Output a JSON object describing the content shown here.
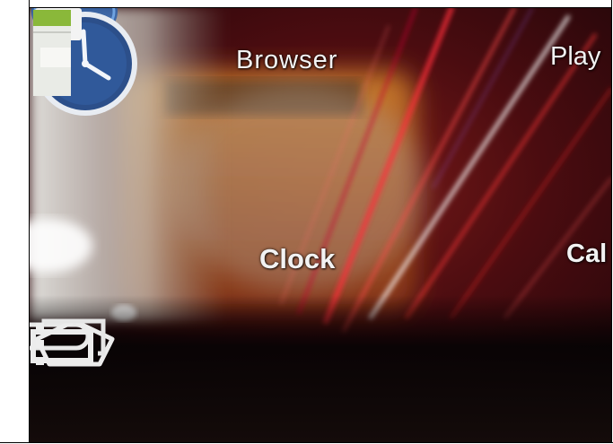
{
  "home_screen": {
    "apps": [
      {
        "label": "Browser",
        "icon": "browser-globe-icon"
      },
      {
        "label": "Clock",
        "icon": "clock-icon"
      },
      {
        "label": "Play",
        "icon": "play-store-icon"
      },
      {
        "label": "Cal",
        "icon": "calendar-icon"
      }
    ]
  },
  "nav_bar": {
    "buttons": [
      {
        "name": "back",
        "icon": "back-arrow-icon"
      },
      {
        "name": "home",
        "icon": "home-icon"
      },
      {
        "name": "recent-apps",
        "icon": "recent-apps-icon"
      },
      {
        "name": "menu",
        "icon": "menu-dots-icon"
      }
    ]
  },
  "colors": {
    "wallpaper_red": "#c8102e",
    "clock_blue": "#2c4f8a",
    "frame": "#000000"
  }
}
